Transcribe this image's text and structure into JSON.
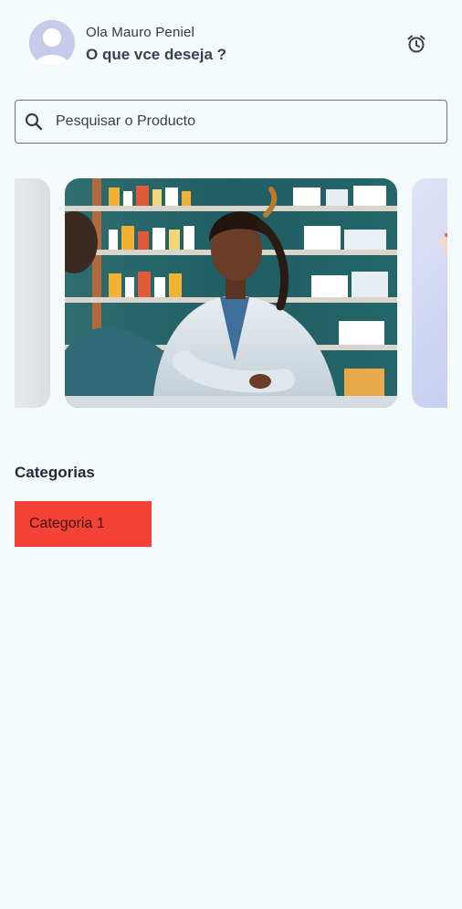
{
  "header": {
    "greeting": "Ola Mauro Peniel",
    "prompt": "O que vce deseja ?",
    "avatar_icon": "user-avatar-icon",
    "alarm_icon": "alarm-clock-icon"
  },
  "search": {
    "placeholder": "Pesquisar o Producto",
    "value": "",
    "icon": "search-icon"
  },
  "carousel": {
    "slides": [
      {
        "name": "previous-slide-image"
      },
      {
        "name": "pharmacist-slide-image"
      },
      {
        "name": "next-slide-image"
      }
    ]
  },
  "categories": {
    "title": "Categorias",
    "items": [
      {
        "label": "Categoria 1",
        "color": "#f44336"
      }
    ]
  },
  "colors": {
    "background": "#f5fafa",
    "accent": "#f44336"
  }
}
